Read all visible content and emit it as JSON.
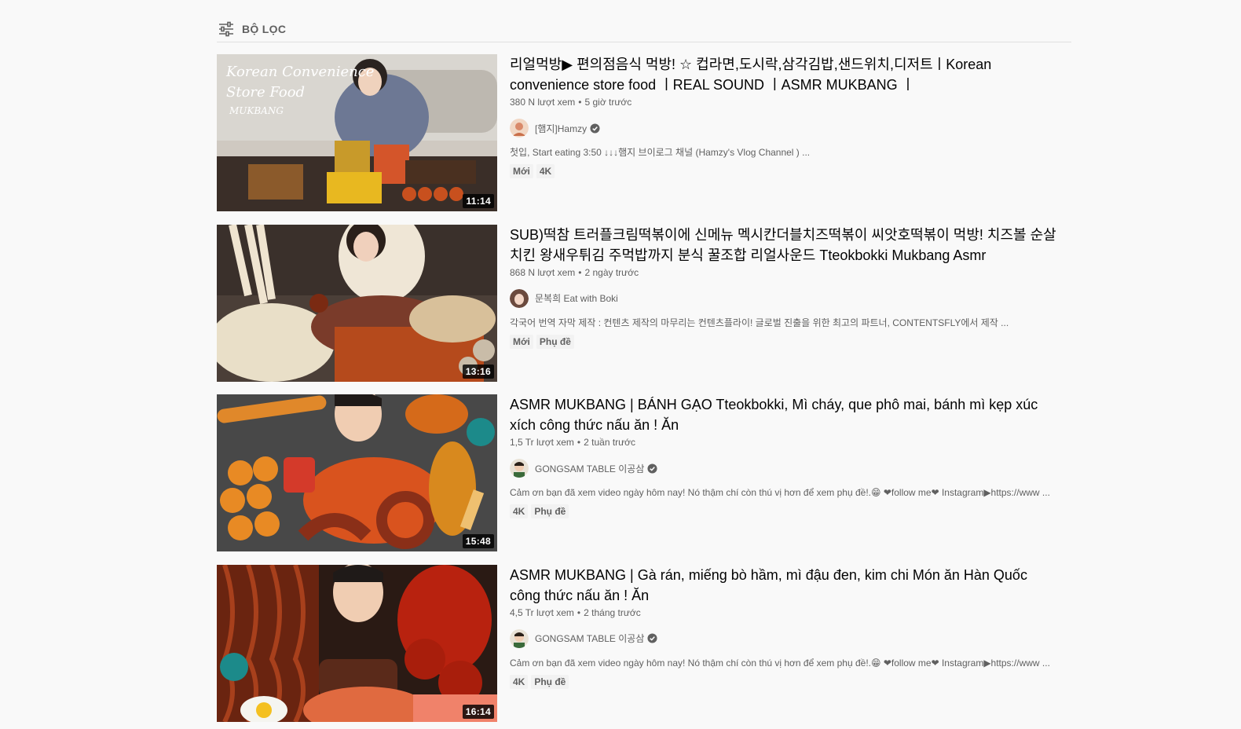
{
  "filter": {
    "label": "BỘ LỌC",
    "icon": "filter-sliders-icon"
  },
  "videos": [
    {
      "title": "리얼먹방▶ 편의점음식 먹방! ☆ 컵라면,도시락,삼각김밥,샌드위치,디저트ㅣKorean convenience store food ㅣREAL SOUND ㅣASMR MUKBANG ㅣ",
      "views": "380 N lượt xem",
      "age": "5 giờ trước",
      "channel": "[햄지]Hamzy",
      "verified": true,
      "description": "첫입, Start eating 3:50 ↓↓↓햄지 브이로그 채널 (Hamzy's Vlog Channel ) ...",
      "badges": [
        "Mới",
        "4K"
      ],
      "duration": "11:14",
      "thumb_text": [
        "Korean Convenience",
        "Store Food",
        "MUKBANG"
      ],
      "thumb_color": "#c9c3bb"
    },
    {
      "title": "SUB)떡참 트러플크림떡볶이에 신메뉴 멕시칸더블치즈떡볶이 씨앗호떡볶이 먹방! 치즈볼 순살치킨 왕새우튀김 주먹밥까지 분식 꿀조합 리얼사운드 Tteokbokki Mukbang Asmr",
      "views": "868 N lượt xem",
      "age": "2 ngày trước",
      "channel": "문복희 Eat with Boki",
      "verified": false,
      "description": "각국어 번역 자막 제작 : 컨텐츠 제작의 마무리는 컨텐츠플라이! 글로벌 진출을 위한 최고의 파트너, CONTENTSFLY에서 제작 ...",
      "badges": [
        "Mới",
        "Phụ đề"
      ],
      "duration": "13:16",
      "thumb_color": "#5a4a40"
    },
    {
      "title": "ASMR MUKBANG | BÁNH GẠO Tteokbokki, Mì cháy, que phô mai, bánh mì kẹp xúc xích công thức nấu ăn ! Ăn",
      "views": "1,5 Tr lượt xem",
      "age": "2 tuần trước",
      "channel": "GONGSAM TABLE 이공삼",
      "verified": true,
      "description": "Cảm ơn bạn đã xem video ngày hôm nay! Nó thậm chí còn thú vị hơn để xem phụ đề!.😁 ❤follow me❤ Instagram▶https://www ...",
      "badges": [
        "4K",
        "Phụ đề"
      ],
      "duration": "15:48",
      "thumb_color": "#3c3c3c"
    },
    {
      "title": "ASMR MUKBANG | Gà rán, miếng bò hầm, mì đậu đen, kim chi Món ăn Hàn Quốc công thức nấu ăn ! Ăn",
      "views": "4,5 Tr lượt xem",
      "age": "2 tháng trước",
      "channel": "GONGSAM TABLE 이공삼",
      "verified": true,
      "description": "Cảm ơn bạn đã xem video ngày hôm nay! Nó thậm chí còn thú vị hơn để xem phụ đề!.😁 ❤follow me❤ Instagram▶https://www ...",
      "badges": [
        "4K",
        "Phụ đề"
      ],
      "duration": "16:14",
      "thumb_color": "#2a1a14"
    }
  ]
}
